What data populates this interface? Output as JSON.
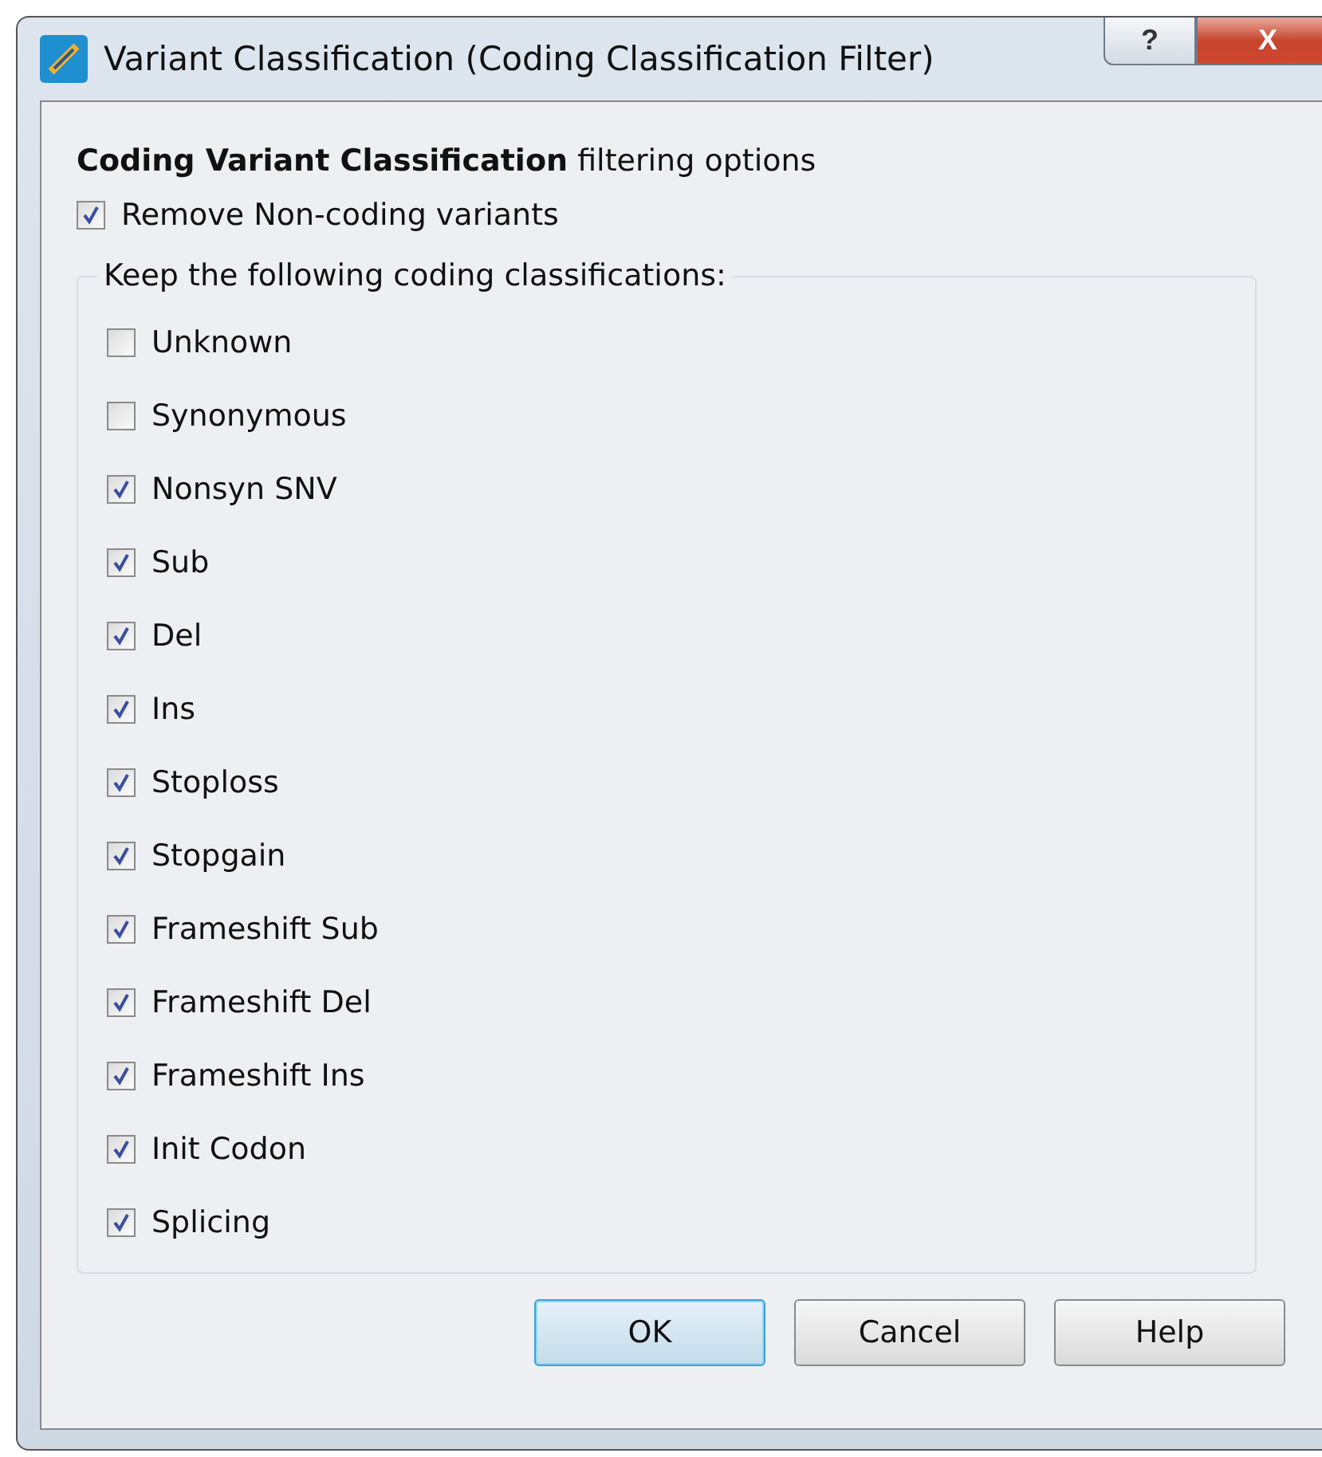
{
  "window": {
    "title": "Variant Classification (Coding Classification Filter)",
    "controls": [
      "?",
      "X"
    ]
  },
  "heading": "**Coding Variant Classification** filtering options",
  "remove_noncoding": {
    "label": "Remove Non-coding variants",
    "checked": true
  },
  "group": {
    "title": "Keep the following coding classifications:",
    "items": [
      {
        "label": "Unknown",
        "checked": false
      },
      {
        "label": "Synonymous",
        "checked": false
      },
      {
        "label": "Nonsyn SNV",
        "checked": true
      },
      {
        "label": "Sub",
        "checked": true
      },
      {
        "label": "Del",
        "checked": true
      },
      {
        "label": "Ins",
        "checked": true
      },
      {
        "label": "Stoploss",
        "checked": true
      },
      {
        "label": "Stopgain",
        "checked": true
      },
      {
        "label": "Frameshift Sub",
        "checked": true
      },
      {
        "label": "Frameshift Del",
        "checked": true
      },
      {
        "label": "Frameshift Ins",
        "checked": true
      },
      {
        "label": "Init Codon",
        "checked": true
      },
      {
        "label": "Splicing",
        "checked": true
      }
    ]
  },
  "buttons": [
    {
      "label": "OK",
      "default": true
    },
    {
      "label": "Cancel",
      "default": false
    },
    {
      "label": "Help",
      "default": false
    }
  ]
}
